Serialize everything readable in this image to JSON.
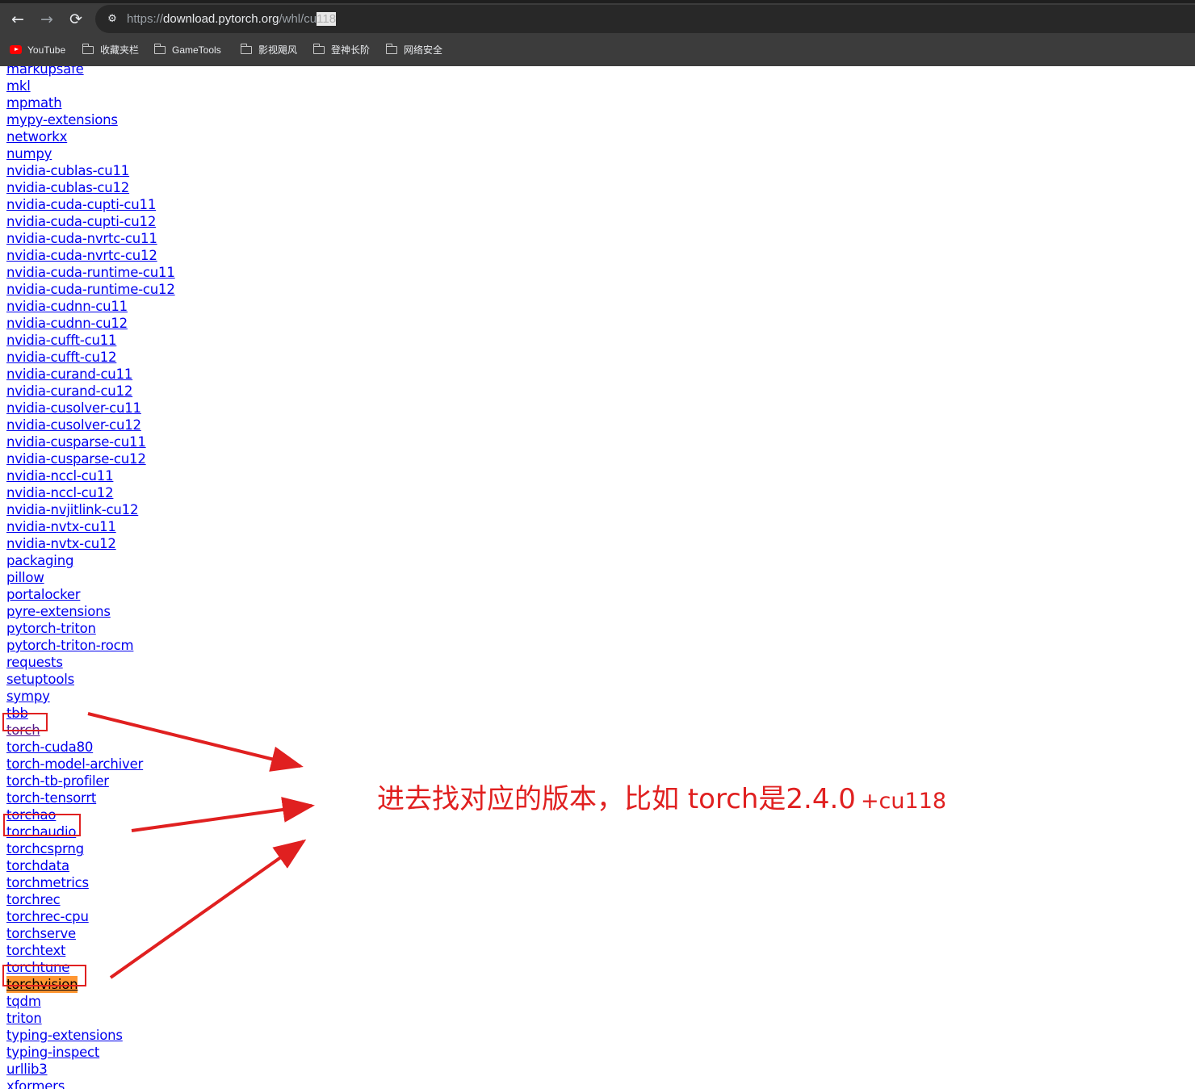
{
  "browser": {
    "nav": {
      "back": "←",
      "forward": "→",
      "reload": "⟳"
    },
    "address_bar": {
      "scheme": "https://",
      "host": "download.pytorch.org",
      "path": "/whl/cu",
      "path_selected": "118"
    },
    "bookmarks": [
      {
        "label": "YouTube",
        "icon": "youtube-icon"
      },
      {
        "label": "收藏夹栏",
        "icon": "folder-icon"
      },
      {
        "label": "GameTools",
        "icon": "folder-icon"
      },
      {
        "label": "影视飓风",
        "icon": "folder-icon"
      },
      {
        "label": "登神长阶",
        "icon": "folder-icon"
      },
      {
        "label": "网络安全",
        "icon": "folder-icon"
      }
    ]
  },
  "packages": [
    "markupsafe",
    "mkl",
    "mpmath",
    "mypy-extensions",
    "networkx",
    "numpy",
    "nvidia-cublas-cu11",
    "nvidia-cublas-cu12",
    "nvidia-cuda-cupti-cu11",
    "nvidia-cuda-cupti-cu12",
    "nvidia-cuda-nvrtc-cu11",
    "nvidia-cuda-nvrtc-cu12",
    "nvidia-cuda-runtime-cu11",
    "nvidia-cuda-runtime-cu12",
    "nvidia-cudnn-cu11",
    "nvidia-cudnn-cu12",
    "nvidia-cufft-cu11",
    "nvidia-cufft-cu12",
    "nvidia-curand-cu11",
    "nvidia-curand-cu12",
    "nvidia-cusolver-cu11",
    "nvidia-cusolver-cu12",
    "nvidia-cusparse-cu11",
    "nvidia-cusparse-cu12",
    "nvidia-nccl-cu11",
    "nvidia-nccl-cu12",
    "nvidia-nvjitlink-cu12",
    "nvidia-nvtx-cu11",
    "nvidia-nvtx-cu12",
    "packaging",
    "pillow",
    "portalocker",
    "pyre-extensions",
    "pytorch-triton",
    "pytorch-triton-rocm",
    "requests",
    "setuptools",
    "sympy",
    "tbb",
    "torch",
    "torch-cuda80",
    "torch-model-archiver",
    "torch-tb-profiler",
    "torch-tensorrt",
    "torchao",
    "torchaudio",
    "torchcsprng",
    "torchdata",
    "torchmetrics",
    "torchrec",
    "torchrec-cpu",
    "torchserve",
    "torchtext",
    "torchtune",
    "torchvision",
    "tqdm",
    "triton",
    "typing-extensions",
    "typing-inspect",
    "urllib3",
    "xformers"
  ],
  "visited_packages": [
    "torch"
  ],
  "highlighted_package": "torchvision",
  "annotation": {
    "text": "进去找对应的版本，比如 torch是2.4.0",
    "suffix": "+cu118",
    "color": "#e02020"
  }
}
